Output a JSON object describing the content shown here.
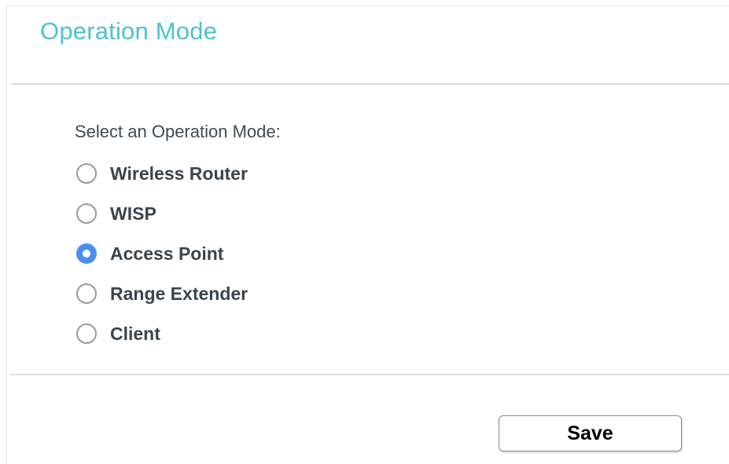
{
  "header": {
    "title": "Operation Mode"
  },
  "form": {
    "section_label": "Select an Operation Mode:",
    "options": [
      {
        "label": "Wireless Router",
        "checked": false
      },
      {
        "label": "WISP",
        "checked": false
      },
      {
        "label": "Access Point",
        "checked": true
      },
      {
        "label": "Range Extender",
        "checked": false
      },
      {
        "label": "Client",
        "checked": false
      }
    ],
    "selected": "Access Point"
  },
  "footer": {
    "save_label": "Save"
  },
  "colors": {
    "title": "#4bc3d0",
    "radio_selected": "#4a8ff0",
    "radio_unselected_border": "#9a9a9a",
    "text": "#3a444c"
  }
}
